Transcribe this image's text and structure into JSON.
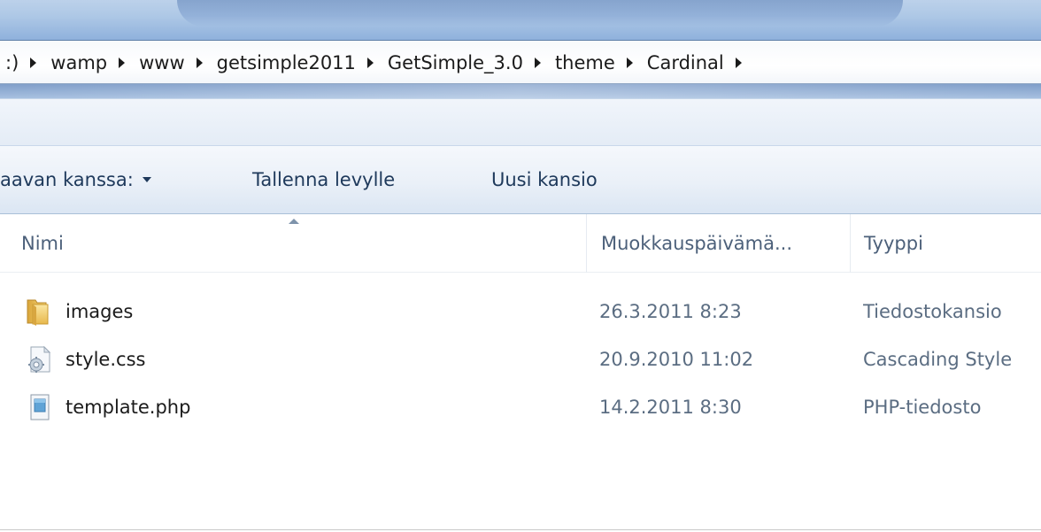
{
  "address_bar": {
    "crumbs": [
      ":)",
      "wamp",
      "www",
      "getsimple2011",
      "GetSimple_3.0",
      "theme",
      "Cardinal"
    ]
  },
  "command_bar": {
    "share_label": "aavan kanssa:",
    "burn_label": "Tallenna levylle",
    "new_folder_label": "Uusi kansio"
  },
  "columns": {
    "name": "Nimi",
    "date_modified": "Muokkauspäivämä...",
    "type": "Tyyppi"
  },
  "files": [
    {
      "name": "images",
      "date": "26.3.2011 8:23",
      "type": "Tiedostokansio",
      "icon": "folder-icon"
    },
    {
      "name": "style.css",
      "date": "20.9.2010 11:02",
      "type": "Cascading Style",
      "icon": "css-file-icon"
    },
    {
      "name": "template.php",
      "date": "14.2.2011 8:30",
      "type": "PHP-tiedosto",
      "icon": "php-file-icon"
    }
  ],
  "colors": {
    "chrome_blue": "#aec8e6",
    "command_text": "#1e395b",
    "header_text": "#4c607a",
    "secondary_text": "#5b6d82"
  }
}
